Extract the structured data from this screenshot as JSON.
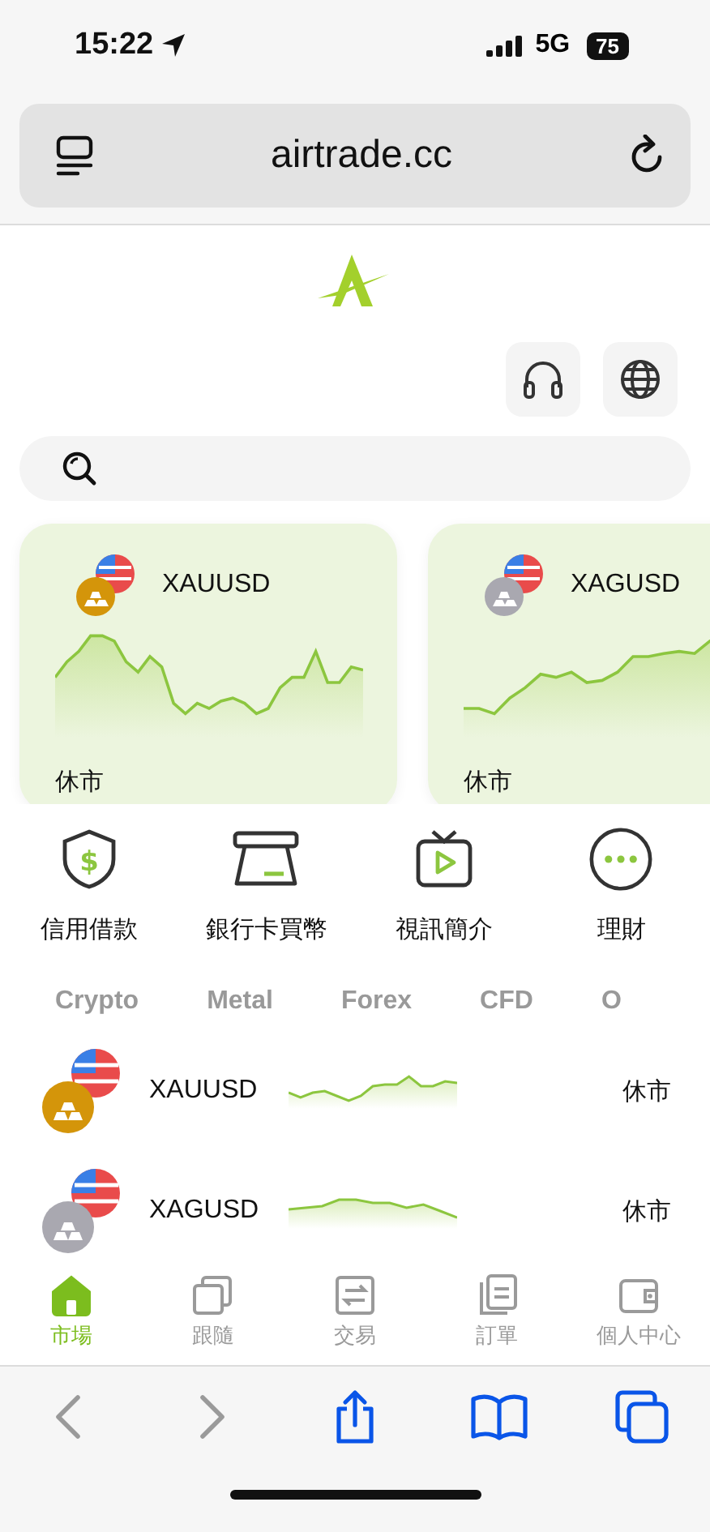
{
  "status_bar": {
    "time": "15:22",
    "network": "5G",
    "battery": "75"
  },
  "address_bar": {
    "url": "airtrade.cc"
  },
  "featured": [
    {
      "symbol": "XAUUSD",
      "kind": "gold",
      "status": "休市"
    },
    {
      "symbol": "XAGUSD",
      "kind": "silver",
      "status": "休市"
    }
  ],
  "shortcuts": [
    {
      "label": "信用借款",
      "kind": "loan",
      "icon_text": "$"
    },
    {
      "label": "銀行卡買幣",
      "kind": "card"
    },
    {
      "label": "視訊簡介",
      "kind": "video"
    },
    {
      "label": "理財",
      "kind": "more"
    }
  ],
  "market_tabs": [
    {
      "label": "Crypto",
      "selected": false
    },
    {
      "label": "Metal",
      "selected": false
    },
    {
      "label": "Forex",
      "selected": false
    },
    {
      "label": "CFD",
      "selected": false
    },
    {
      "label": "O",
      "selected": false
    }
  ],
  "market_rows": [
    {
      "symbol": "XAUUSD",
      "kind": "gold",
      "status": "休市"
    },
    {
      "symbol": "XAGUSD",
      "kind": "silver",
      "status": "休市"
    }
  ],
  "bottom_nav": [
    {
      "label": "市場",
      "kind": "home",
      "selected": true
    },
    {
      "label": "跟隨",
      "kind": "copy",
      "selected": false
    },
    {
      "label": "交易",
      "kind": "swap",
      "selected": false
    },
    {
      "label": "訂單",
      "kind": "orders",
      "selected": false
    },
    {
      "label": "個人中心",
      "kind": "wallet",
      "selected": false
    }
  ],
  "browser_toolbar": [
    {
      "kind": "back",
      "disabled": true
    },
    {
      "kind": "forward",
      "disabled": true
    },
    {
      "kind": "share",
      "disabled": false
    },
    {
      "kind": "bookmarks",
      "disabled": false
    },
    {
      "kind": "tabs",
      "disabled": false
    }
  ]
}
